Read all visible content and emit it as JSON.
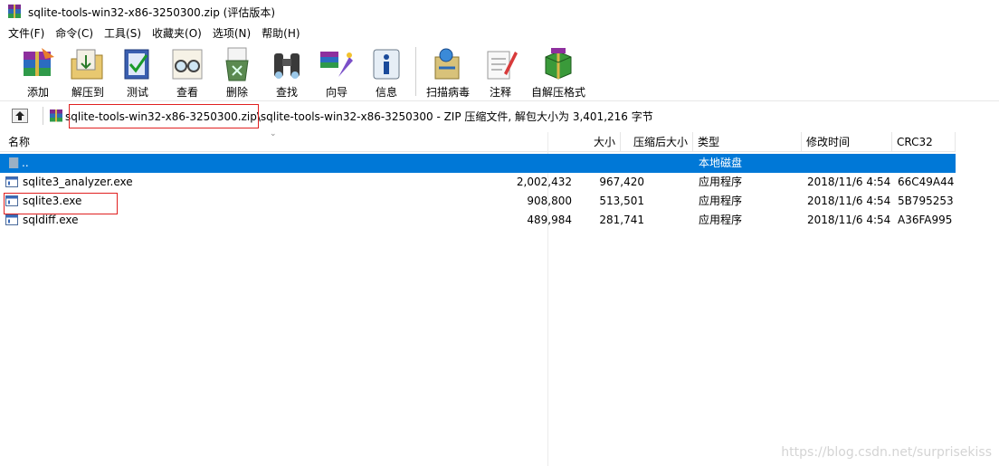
{
  "window": {
    "title": "sqlite-tools-win32-x86-3250300.zip (评估版本)"
  },
  "menu": [
    "文件(F)",
    "命令(C)",
    "工具(S)",
    "收藏夹(O)",
    "选项(N)",
    "帮助(H)"
  ],
  "toolbar": {
    "add": "添加",
    "extract": "解压到",
    "test": "测试",
    "view": "查看",
    "delete": "删除",
    "find": "查找",
    "wizard": "向导",
    "info": "信息",
    "scan": "扫描病毒",
    "comment": "注释",
    "sfx": "自解压格式"
  },
  "address": {
    "zip_name": "sqlite-tools-win32-x86-3250300.zip",
    "rest": "\\sqlite-tools-win32-x86-3250300 - ZIP 压缩文件, 解包大小为 3,401,216 字节"
  },
  "columns": {
    "name": "名称",
    "size": "大小",
    "packed": "压缩后大小",
    "type": "类型",
    "modified": "修改时间",
    "crc": "CRC32"
  },
  "rows": [
    {
      "name": "..",
      "size": "",
      "packed": "",
      "type": "本地磁盘",
      "modified": "",
      "crc": ""
    },
    {
      "name": "sqlite3_analyzer.exe",
      "size": "2,002,432",
      "packed": "967,420",
      "type": "应用程序",
      "modified": "2018/11/6 4:54",
      "crc": "66C49A44"
    },
    {
      "name": "sqlite3.exe",
      "size": "908,800",
      "packed": "513,501",
      "type": "应用程序",
      "modified": "2018/11/6 4:54",
      "crc": "5B795253"
    },
    {
      "name": "sqldiff.exe",
      "size": "489,984",
      "packed": "281,741",
      "type": "应用程序",
      "modified": "2018/11/6 4:54",
      "crc": "A36FA995"
    }
  ],
  "watermark": "https://blog.csdn.net/surprisekiss",
  "colors": {
    "selection": "#0078d7",
    "highlight_box": "#e02020"
  }
}
